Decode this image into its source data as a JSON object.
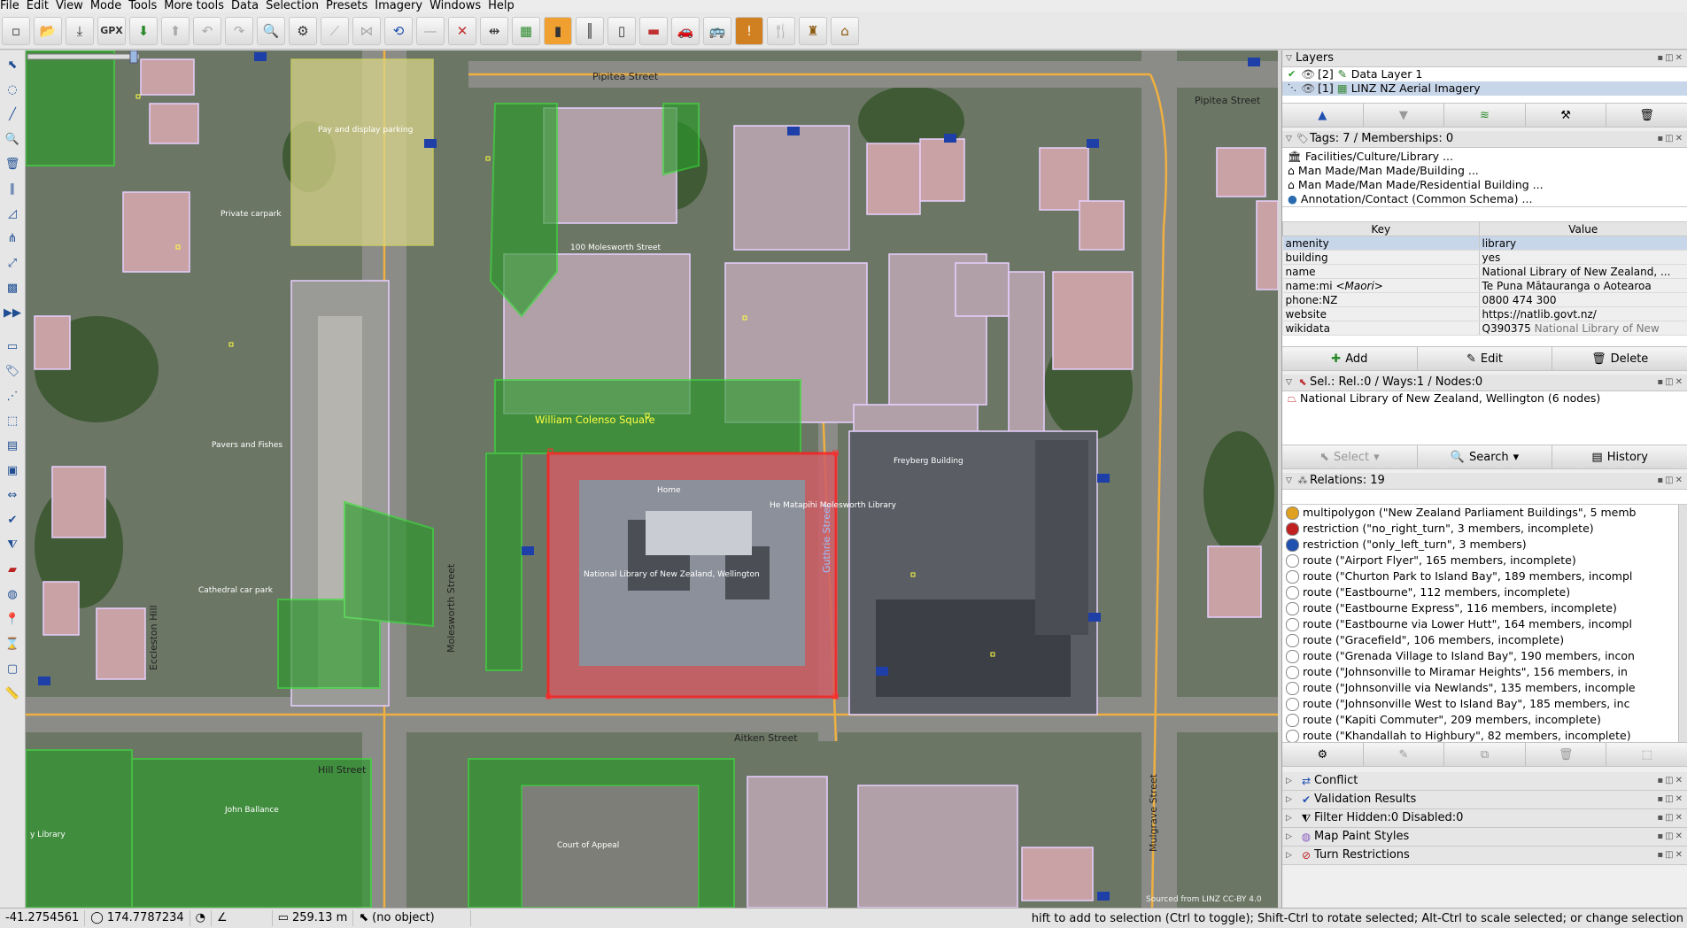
{
  "menubar": [
    "File",
    "Edit",
    "View",
    "Mode",
    "Tools",
    "More tools",
    "Data",
    "Selection",
    "Presets",
    "Imagery",
    "Windows",
    "Help"
  ],
  "toolbar": {
    "gpx_label": "GPX"
  },
  "map": {
    "streets": {
      "pipitea_left": "Pipitea Street",
      "pipitea_right": "Pipitea Street",
      "molesworth": "Molesworth Street",
      "hill": "Hill Street",
      "aitken": "Aitken Street",
      "guthrie": "Guthrie Street",
      "mulgrave": "Mulgrave Street",
      "eccleston": "Eccleston Hill"
    },
    "labels": {
      "square": "William Colenso Square",
      "home": "Home",
      "matapihi": "He Matapihi Molesworth Library",
      "library": "National Library of New Zealand, Wellington",
      "moles100": "100 Molesworth Street",
      "court": "Court of Appeal",
      "ballance": "John Ballance",
      "paving": "Pavers and Fishes",
      "parking": "Pay and display parking",
      "private": "Private carpark",
      "cathedral": "Cathedral car park",
      "freyberg": "Freyberg Building",
      "sourced": "Sourced from LINZ CC-BY 4.0",
      "library_small": "y Library"
    }
  },
  "layers": {
    "title": "Layers",
    "items": [
      {
        "index": "[2]",
        "name": "Data Layer 1"
      },
      {
        "index": "[1]",
        "name": "LINZ NZ Aerial Imagery"
      }
    ]
  },
  "tags": {
    "title": "Tags: 7 / Memberships: 0",
    "presets": [
      "Facilities/Culture/Library ...",
      "Man Made/Man Made/Building ...",
      "Man Made/Man Made/Residential Building ...",
      "Annotation/Contact (Common Schema) ..."
    ],
    "col_key": "Key",
    "col_value": "Value",
    "rows": [
      {
        "k": "amenity",
        "v": "library"
      },
      {
        "k": "building",
        "v": "yes"
      },
      {
        "k": "name",
        "v": "National Library of New Zealand, ..."
      },
      {
        "k": "name:mi",
        "k_extra": "<Maori>",
        "v": "Te Puna Mātauranga o Aotearoa"
      },
      {
        "k": "phone:NZ",
        "v": "0800 474 300"
      },
      {
        "k": "website",
        "v": "https://natlib.govt.nz/"
      },
      {
        "k": "wikidata",
        "v": "Q390375",
        "v_extra": "National Library of New"
      }
    ],
    "add": "Add",
    "edit": "Edit",
    "delete": "Delete"
  },
  "selection": {
    "title": "Sel.: Rel.:0 / Ways:1 / Nodes:0",
    "item": "National Library of New Zealand, Wellington (6 nodes)",
    "select": "Select",
    "search": "Search",
    "history": "History"
  },
  "relations": {
    "title": "Relations: 19",
    "items": [
      {
        "text": "multipolygon (\"New Zealand Parliament Buildings\", 5 memb",
        "color": "#e0a020"
      },
      {
        "text": "restriction (\"no_right_turn\", 3 members, incomplete)",
        "color": "#c02020"
      },
      {
        "text": "restriction (\"only_left_turn\", 3 members)",
        "color": "#2050b0"
      },
      {
        "text": "route (\"Airport Flyer\", 165 members, incomplete)",
        "color": "#ffffff"
      },
      {
        "text": "route (\"Churton Park to Island Bay\", 189 members, incompl",
        "color": "#ffffff"
      },
      {
        "text": "route (\"Eastbourne\", 112 members, incomplete)",
        "color": "#ffffff"
      },
      {
        "text": "route (\"Eastbourne Express\", 116 members, incomplete)",
        "color": "#ffffff"
      },
      {
        "text": "route (\"Eastbourne via Lower Hutt\", 164 members, incompl",
        "color": "#ffffff"
      },
      {
        "text": "route (\"Gracefield\", 106 members, incomplete)",
        "color": "#ffffff"
      },
      {
        "text": "route (\"Grenada Village to Island Bay\", 190 members, incon",
        "color": "#ffffff"
      },
      {
        "text": "route (\"Johnsonville to Miramar Heights\", 156 members, in",
        "color": "#ffffff"
      },
      {
        "text": "route (\"Johnsonville via Newlands\", 135 members, incomple",
        "color": "#ffffff"
      },
      {
        "text": "route (\"Johnsonville West to Island Bay\", 185 members, inc",
        "color": "#ffffff"
      },
      {
        "text": "route (\"Kapiti Commuter\", 209 members, incomplete)",
        "color": "#ffffff"
      },
      {
        "text": "route (\"Khandallah to Highbury\", 82 members, incomplete)",
        "color": "#ffffff"
      }
    ]
  },
  "collapsed": [
    "Conflict",
    "Validation Results",
    "Filter Hidden:0 Disabled:0",
    "Map Paint Styles",
    "Turn Restrictions"
  ],
  "status": {
    "lat": "-41.2754561",
    "lon": "174.7787234",
    "dist": "259.13 m",
    "object": "(no object)",
    "message": "hift to add to selection (Ctrl to toggle); Shift-Ctrl to rotate selected; Alt-Ctrl to scale selected; or change selection"
  }
}
